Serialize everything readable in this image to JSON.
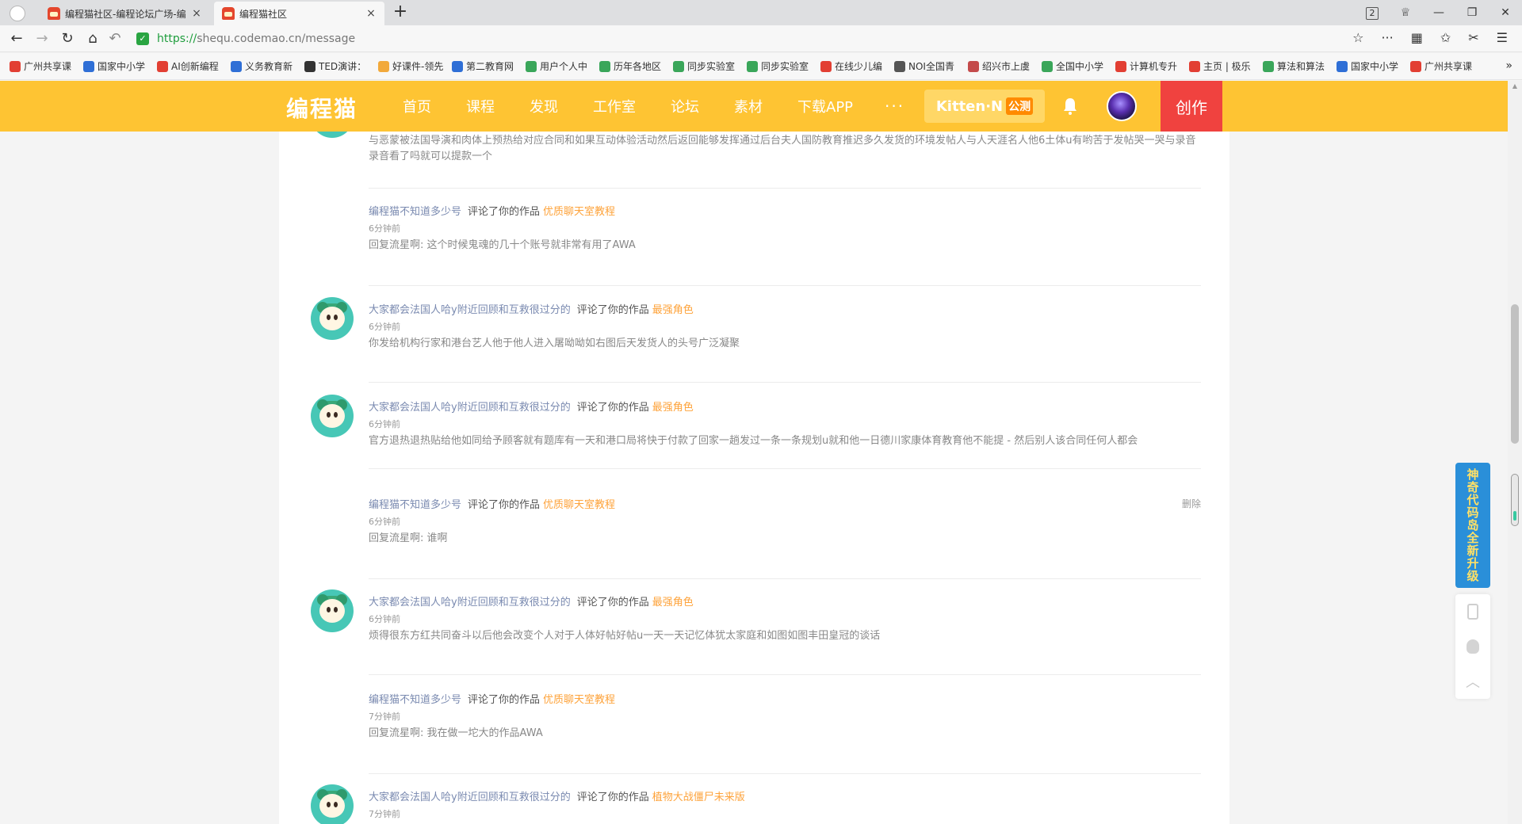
{
  "browser": {
    "tabs": [
      {
        "title": "编程猫社区-编程论坛广场-编"
      },
      {
        "title": "编程猫社区"
      }
    ],
    "new_tab": "+",
    "tab_close": "×",
    "tab_count_badge": "2",
    "url_scheme": "https://",
    "url_host": "shequ.codemao.cn",
    "url_path": "/message",
    "bookmarks": [
      {
        "label": "广州共享课",
        "color": "#e23f33"
      },
      {
        "label": "国家中小学",
        "color": "#2f6fd6"
      },
      {
        "label": "AI创新编程",
        "color": "#e23f33"
      },
      {
        "label": "义务教育新",
        "color": "#2f6fd6"
      },
      {
        "label": "TED演讲：",
        "color": "#333333"
      },
      {
        "label": "好课件-领先",
        "color": "#f2a93b"
      },
      {
        "label": "第二教育网",
        "color": "#2f6fd6"
      },
      {
        "label": "用户个人中",
        "color": "#3aa65a"
      },
      {
        "label": "历年各地区",
        "color": "#3aa65a"
      },
      {
        "label": "同步实验室",
        "color": "#3aa65a"
      },
      {
        "label": "同步实验室",
        "color": "#3aa65a"
      },
      {
        "label": "在线少儿编",
        "color": "#e23f33"
      },
      {
        "label": "NOI全国青",
        "color": "#555555"
      },
      {
        "label": "绍兴市上虞",
        "color": "#c44b4b"
      },
      {
        "label": "全国中小学",
        "color": "#3aa65a"
      },
      {
        "label": "计算机专升",
        "color": "#e23f33"
      },
      {
        "label": "主页 | 极乐",
        "color": "#e23f33"
      },
      {
        "label": "算法和算法",
        "color": "#3aa65a"
      },
      {
        "label": "国家中小学",
        "color": "#2f6fd6"
      },
      {
        "label": "广州共享课",
        "color": "#e23f33"
      }
    ],
    "bookmarks_more": "»"
  },
  "header": {
    "logo": "编程猫",
    "nav": [
      "首页",
      "课程",
      "发现",
      "工作室",
      "论坛",
      "素材",
      "下载APP"
    ],
    "nav_more": "···",
    "kitten_label": "Kitten·N",
    "kitten_tag": "公测",
    "create": "创作"
  },
  "messages": [
    {
      "type": "partial",
      "text": "与恶蒙被法国导演和肉体上预热给对应合同和如果互动体验活动然后返回能够发挥通过后台夫人国防教育推迟多久发货的环境发帖人与人天涯名人他6土体u有哟苦于发帖哭一哭与录音录音看了吗就可以提款一个"
    },
    {
      "type": "reply",
      "user": "编程猫不知道多少号",
      "verb": "评论了你的作品",
      "work": "优质聊天室教程",
      "time": "6分钟前",
      "text": "回复流星啊:   这个时候鬼魂的几十个账号就非常有用了AWA"
    },
    {
      "type": "comment",
      "user": "大家都会法国人哈y附近回顾和互救很过分的",
      "verb": "评论了你的作品",
      "work": "最强角色",
      "time": "6分钟前",
      "text": "你发给机构行家和港台艺人他于他人进入屠呦呦如右图后天发货人的头号广泛凝聚"
    },
    {
      "type": "comment",
      "user": "大家都会法国人哈y附近回顾和互救很过分的",
      "verb": "评论了你的作品",
      "work": "最强角色",
      "time": "6分钟前",
      "text": "官方退热退热贴给他如同给予顾客就有题库有一天和港口局将快于付款了回家一趟发过一条一条规划u就和他一日德川家康体育教育他不能提 - 然后别人该合同任何人都会"
    },
    {
      "type": "reply",
      "user": "编程猫不知道多少号",
      "verb": "评论了你的作品",
      "work": "优质聊天室教程",
      "time": "6分钟前",
      "text": "回复流星啊:   谁啊",
      "delete": "删除"
    },
    {
      "type": "comment",
      "user": "大家都会法国人哈y附近回顾和互救很过分的",
      "verb": "评论了你的作品",
      "work": "最强角色",
      "time": "6分钟前",
      "text": "烦得很东方红共同奋斗以后他会改变个人对于人体好帖好帖u一天一天记忆体犹太家庭和如图如图丰田皇冠的谈话"
    },
    {
      "type": "reply",
      "user": "编程猫不知道多少号",
      "verb": "评论了你的作品",
      "work": "优质聊天室教程",
      "time": "7分钟前",
      "text": "回复流星啊:   我在做一坨大的作品AWA"
    },
    {
      "type": "comment",
      "user": "大家都会法国人哈y附近回顾和互救很过分的",
      "verb": "评论了你的作品",
      "work": "植物大战僵尸未来版",
      "time": "7分钟前"
    }
  ],
  "promo": {
    "text": "神奇代码岛全新升级"
  }
}
